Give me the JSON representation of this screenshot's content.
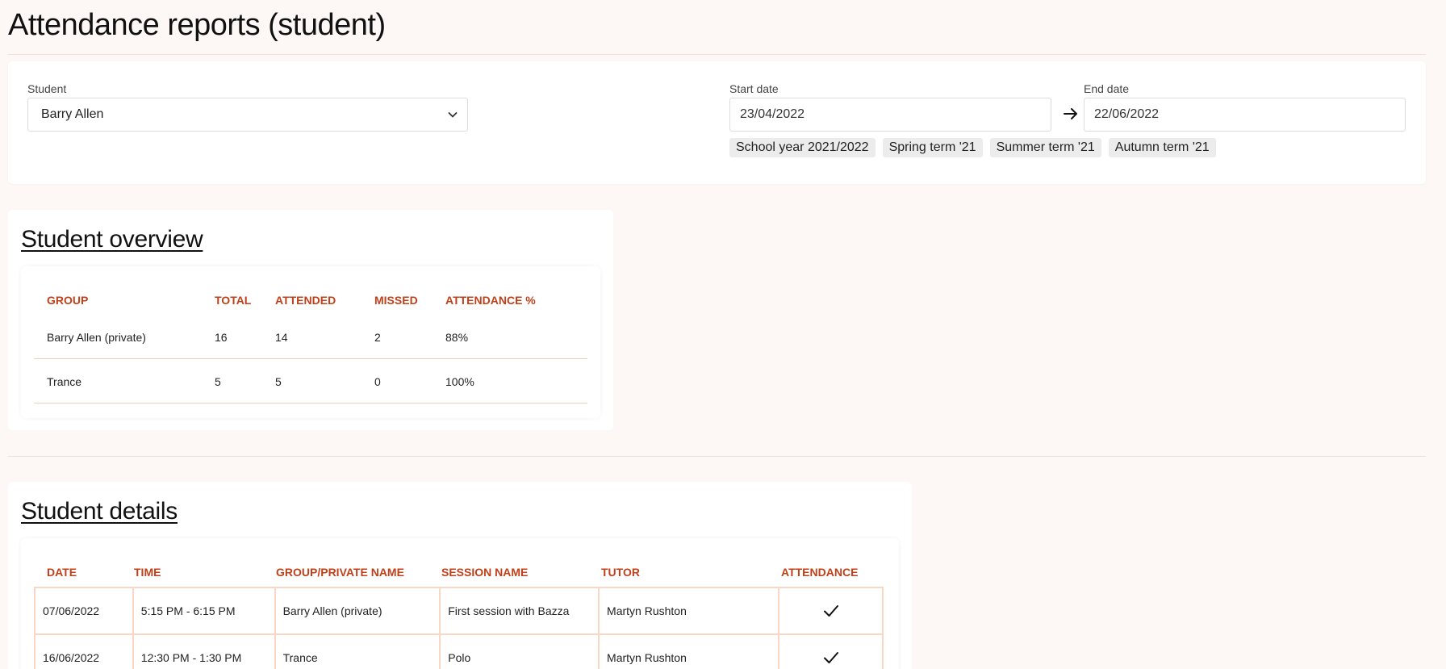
{
  "page": {
    "title": "Attendance reports (student)"
  },
  "filters": {
    "student_label": "Student",
    "student_value": "Barry Allen",
    "start_label": "Start date",
    "start_value": "23/04/2022",
    "end_label": "End date",
    "end_value": "22/06/2022",
    "chips": [
      "School year 2021/2022",
      "Spring term '21",
      "Summer term '21",
      "Autumn term '21"
    ]
  },
  "overview": {
    "title": "Student overview",
    "headers": [
      "GROUP",
      "TOTAL",
      "ATTENDED",
      "MISSED",
      "ATTENDANCE %"
    ],
    "rows": [
      [
        "Barry Allen (private)",
        "16",
        "14",
        "2",
        "88%"
      ],
      [
        "Trance",
        "5",
        "5",
        "0",
        "100%"
      ]
    ]
  },
  "details": {
    "title": "Student details",
    "headers": [
      "DATE",
      "TIME",
      "GROUP/PRIVATE NAME",
      "SESSION NAME",
      "TUTOR",
      "ATTENDANCE"
    ],
    "rows": [
      [
        "07/06/2022",
        "5:15 PM - 6:15 PM",
        "Barry Allen (private)",
        "First session with Bazza",
        "Martyn Rushton",
        "attended"
      ],
      [
        "16/06/2022",
        "12:30 PM - 1:30 PM",
        "Trance",
        "Polo",
        "Martyn Rushton",
        "attended"
      ]
    ]
  },
  "icons": {
    "select_chevron": "chevron-down-icon",
    "date_arrow": "arrow-right-icon",
    "attendance_mark": "checkmark-icon"
  },
  "colors": {
    "header_text": "#c0401a",
    "row_rule": "#f5cfb3",
    "background": "#fdf8f6"
  }
}
